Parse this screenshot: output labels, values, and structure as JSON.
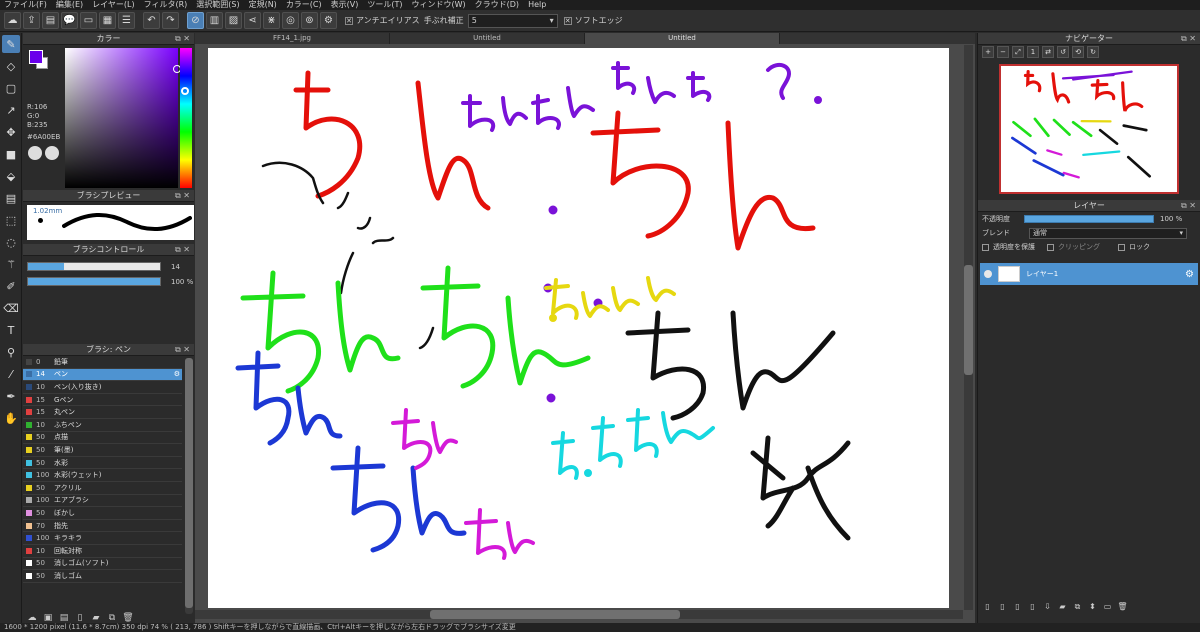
{
  "menu": [
    "ファイル(F)",
    "編集(E)",
    "レイヤー(L)",
    "フィルタ(R)",
    "選択範囲(S)",
    "定規(N)",
    "カラー(C)",
    "表示(V)",
    "ツール(T)",
    "ウィンドウ(W)",
    "クラウド(D)",
    "Help"
  ],
  "toolbar": {
    "antialias_label": "アンチエイリアス",
    "stabilizer_label": "手ぶれ補正",
    "stabilizer_value": "5",
    "soft_edge_label": "ソフトエッジ"
  },
  "panels": {
    "color_title": "カラー",
    "color_r": "R:106",
    "color_g": "G:0",
    "color_b": "B:235",
    "color_hex": "#6A00EB",
    "main_color": "#6a00eb",
    "brush_preview_title": "ブラシプレビュー",
    "brush_size_label": "1.02mm",
    "brush_control_title": "ブラシコントロール",
    "size_value": "14",
    "opacity_value": "100 %",
    "brush_list_title": "ブラシ: ペン"
  },
  "brushes": [
    {
      "num": "0",
      "name": "鉛筆",
      "color": "#444444"
    },
    {
      "num": "14",
      "name": "ペン",
      "color": "#3a6ea5",
      "selected": true
    },
    {
      "num": "10",
      "name": "ペン(入り抜き)",
      "color": "#2a4a7a"
    },
    {
      "num": "15",
      "name": "Gペン",
      "color": "#e04040"
    },
    {
      "num": "15",
      "name": "丸ペン",
      "color": "#e04040"
    },
    {
      "num": "10",
      "name": "ふちペン",
      "color": "#30b030"
    },
    {
      "num": "50",
      "name": "点描",
      "color": "#e8d020"
    },
    {
      "num": "50",
      "name": "筆(墨)",
      "color": "#e8d020"
    },
    {
      "num": "50",
      "name": "水彩",
      "color": "#40c0e0"
    },
    {
      "num": "100",
      "name": "水彩(ウェット)",
      "color": "#40c0e0"
    },
    {
      "num": "50",
      "name": "アクリル",
      "color": "#e8d020"
    },
    {
      "num": "100",
      "name": "エアブラシ",
      "color": "#aaaaaa"
    },
    {
      "num": "50",
      "name": "ぼかし",
      "color": "#e090e0"
    },
    {
      "num": "70",
      "name": "指先",
      "color": "#f0c090"
    },
    {
      "num": "100",
      "name": "キラキラ",
      "color": "#3050d0"
    },
    {
      "num": "10",
      "name": "回転対称",
      "color": "#e04040"
    },
    {
      "num": "50",
      "name": "消しゴム(ソフト)",
      "color": "#ffffff"
    },
    {
      "num": "50",
      "name": "消しゴム",
      "color": "#ffffff"
    }
  ],
  "tabs": [
    "FF14_1.jpg",
    "Untitled",
    "Untitled"
  ],
  "navigator_title": "ナビゲーター",
  "layers": {
    "title": "レイヤー",
    "opacity_label": "不透明度",
    "opacity_value": "100 %",
    "blend_label": "ブレンド",
    "blend_value": "通常",
    "protect_alpha": "透明度を保護",
    "clipping": "クリッピング",
    "lock": "ロック",
    "layer_name": "レイヤー1"
  },
  "status": "1600 * 1200 pixel   (11.6 * 8.7cm)  350 dpi   74 %   ( 213, 786 )   Shiftキーを押しながらで直線描画、Ctrl+Altキーを押しながら左右ドラッグでブラシサイズ変更"
}
